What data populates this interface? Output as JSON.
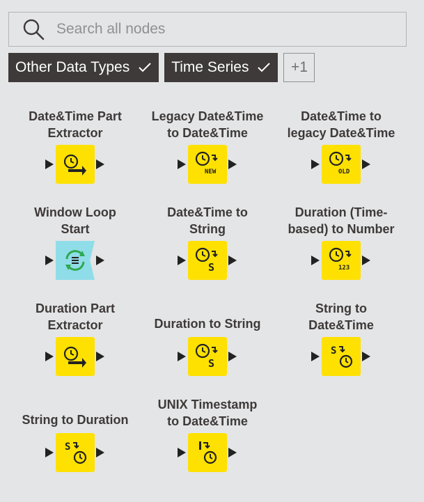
{
  "search": {
    "placeholder": "Search all nodes",
    "value": ""
  },
  "tags": [
    {
      "label": "Other Data Types",
      "color": "#3e3a39"
    },
    {
      "label": "Time Series",
      "color": "#3e3a39"
    }
  ],
  "tags_more": "+1",
  "colors": {
    "node_yellow": "#fee101",
    "node_loop": "#8fdde8",
    "text": "#3e3a39"
  },
  "nodes": [
    {
      "label": "Date&Time Part\nExtractor",
      "icon": "clock-extract-icon"
    },
    {
      "label": "Legacy Date&Time\nto Date&Time",
      "icon": "clock-new-icon",
      "badge": "NEW"
    },
    {
      "label": "Date&Time to\nlegacy Date&Time",
      "icon": "clock-old-icon",
      "badge": "OLD"
    },
    {
      "label": "Window Loop\nStart",
      "icon": "loop-icon"
    },
    {
      "label": "Date&Time to\nString",
      "icon": "clock-to-string-icon",
      "badge": "S"
    },
    {
      "label": "Duration (Time-\nbased) to Number",
      "icon": "duration-to-number-icon",
      "badge": "123"
    },
    {
      "label": "Duration Part\nExtractor",
      "icon": "duration-extract-icon"
    },
    {
      "label": "Duration to String",
      "icon": "duration-to-string-icon",
      "badge": "S"
    },
    {
      "label": "String to\nDate&Time",
      "icon": "string-to-clock-icon",
      "badge": "S"
    },
    {
      "label": "String to Duration",
      "icon": "string-to-duration-icon",
      "badge": "S"
    },
    {
      "label": "UNIX Timestamp\nto Date&Time",
      "icon": "unix-to-clock-icon",
      "badge": "I"
    }
  ]
}
